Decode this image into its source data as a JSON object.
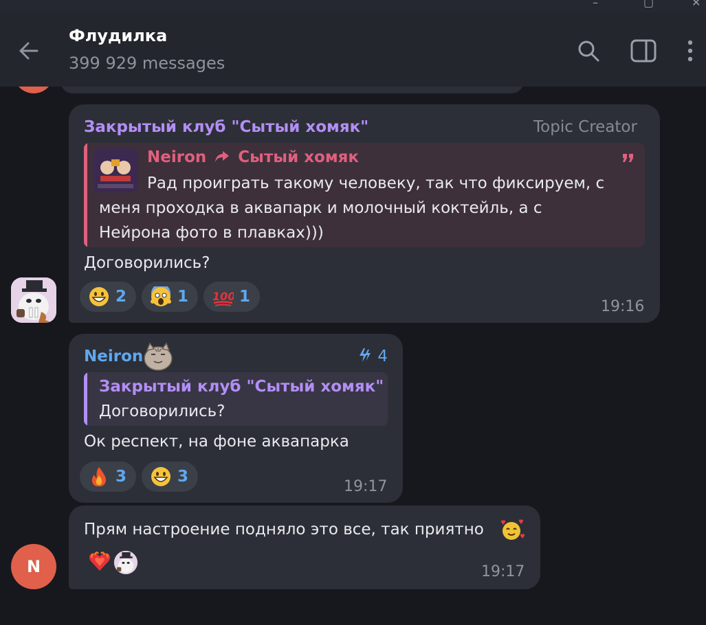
{
  "header": {
    "title": "Флудилка",
    "subtitle": "399 929 messages"
  },
  "messages": [
    {
      "sender": "Закрытый клуб \"Сытый хомяк\"",
      "badge": "Topic Creator",
      "quote": {
        "from": "Neiron",
        "forward_to": "Сытый хомяк",
        "lines": [
          "Рад проиграть такому человеку, так что фиксируем, с",
          "меня проходка в аквапарк и молочный коктейль, а с",
          "Нейрона фото в плавках)))"
        ]
      },
      "text": "Договорились?",
      "reactions": [
        {
          "emoji": "grinning-face",
          "count": "2"
        },
        {
          "emoji": "screaming-face",
          "count": "1"
        },
        {
          "emoji": "hundred-points",
          "count": "1"
        }
      ],
      "time": "19:16"
    },
    {
      "sender": "Neiron",
      "boost": "4",
      "quote": {
        "from": "Закрытый клуб \"Сытый хомяк\"",
        "lines": [
          "Договорились?"
        ]
      },
      "text": "Ок респект, на фоне аквапарка",
      "reactions": [
        {
          "emoji": "fire",
          "count": "3"
        },
        {
          "emoji": "grinning-face",
          "count": "3"
        }
      ],
      "time": "19:17"
    },
    {
      "avatar_letter": "N",
      "text": "Прям настроение подняло это все, так приятно",
      "reactions": [
        {
          "emoji": "heart-on-fire"
        },
        {
          "emoji": "user-avatar"
        }
      ],
      "time": "19:17"
    }
  ],
  "colors": {
    "sender_purple": "#b38ef5",
    "sender_blue": "#5fa8f0",
    "quote_pink": "#e0607e",
    "avatar_red": "#e0604b"
  }
}
